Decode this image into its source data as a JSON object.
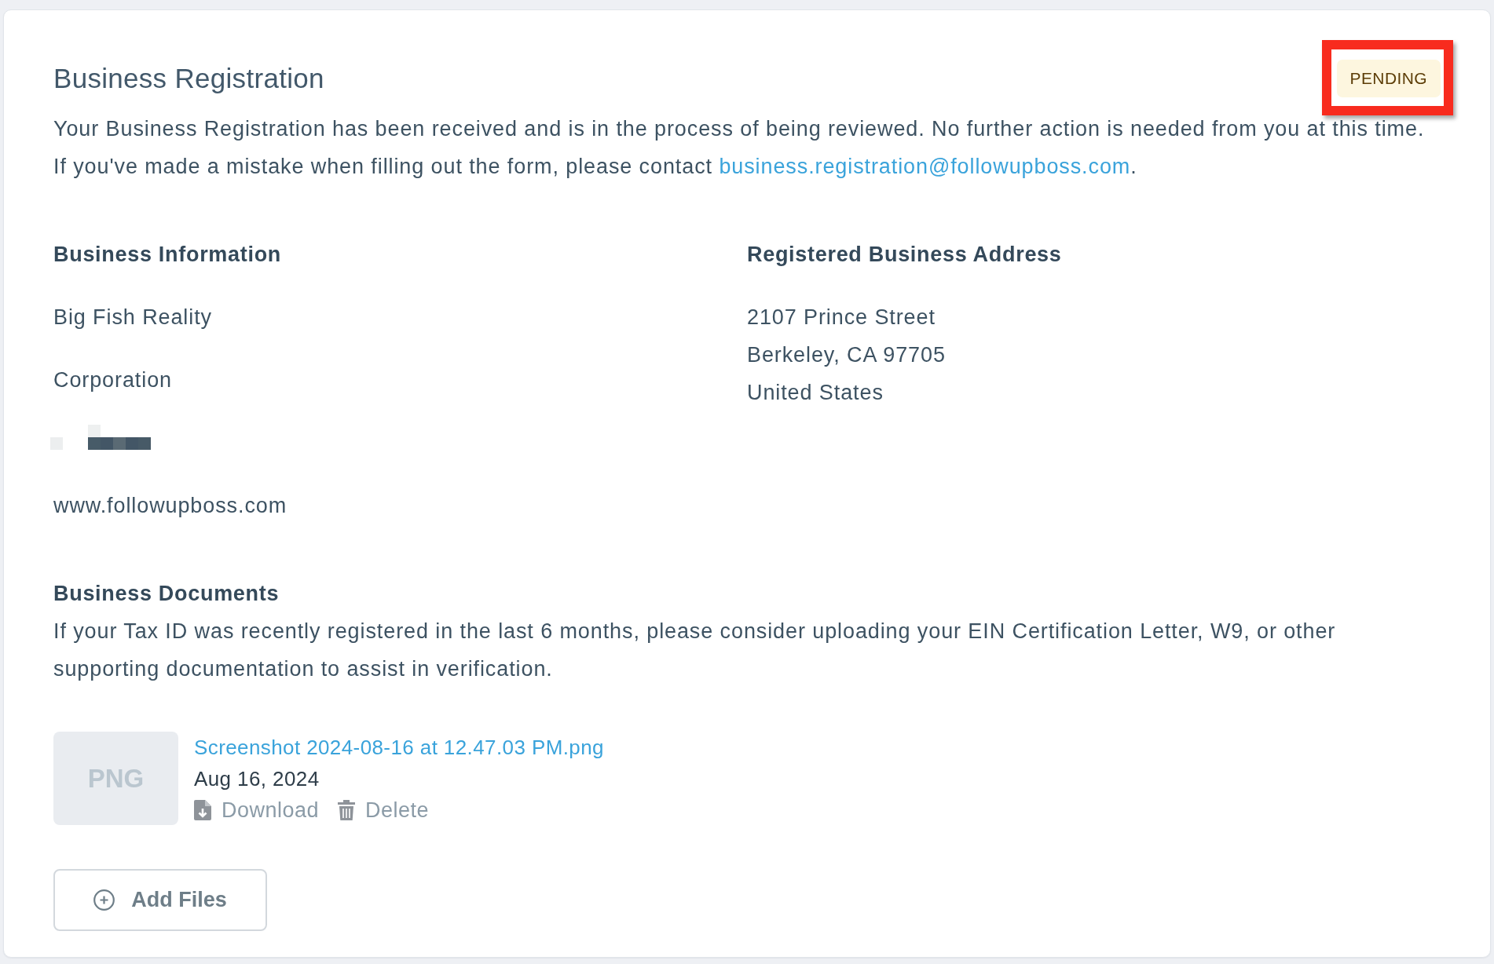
{
  "header": {
    "title": "Business Registration",
    "status": {
      "label": "PENDING",
      "kind": "pending",
      "highlighted": true
    }
  },
  "intro": "Your Business Registration has been received and is in the process of being reviewed. No further action is needed from you at this time.",
  "contact": {
    "text": "If you've made a mistake when filling out the form, please contact",
    "email": "business.registration@followupboss.com",
    "after": "."
  },
  "business_information": {
    "heading": "Business Information",
    "items": [
      {
        "kind": "text",
        "text": "Big Fish Reality"
      },
      {
        "kind": "text",
        "text": "Corporation"
      },
      {
        "kind": "redacted"
      },
      {
        "kind": "text",
        "text": "www.followupboss.com"
      }
    ]
  },
  "registered_address": {
    "heading": "Registered Business Address",
    "lines": [
      "2107 Prince Street",
      "Berkeley, CA 97705",
      "United States"
    ]
  },
  "business_documents": {
    "heading": "Business Documents",
    "description": "If your Tax ID was recently registered in the last 6 months, please consider uploading your EIN Certification Letter, W9, or other supporting documentation to assist in verification.",
    "files": [
      {
        "type_label": "PNG",
        "name": "Screenshot 2024-08-16 at 12.47.03 PM.png",
        "date": "Aug 16, 2024",
        "actions": [
          {
            "kind": "download",
            "label": "Download"
          },
          {
            "kind": "delete",
            "label": "Delete"
          }
        ]
      }
    ],
    "add_button": {
      "label": "Add Files"
    }
  }
}
